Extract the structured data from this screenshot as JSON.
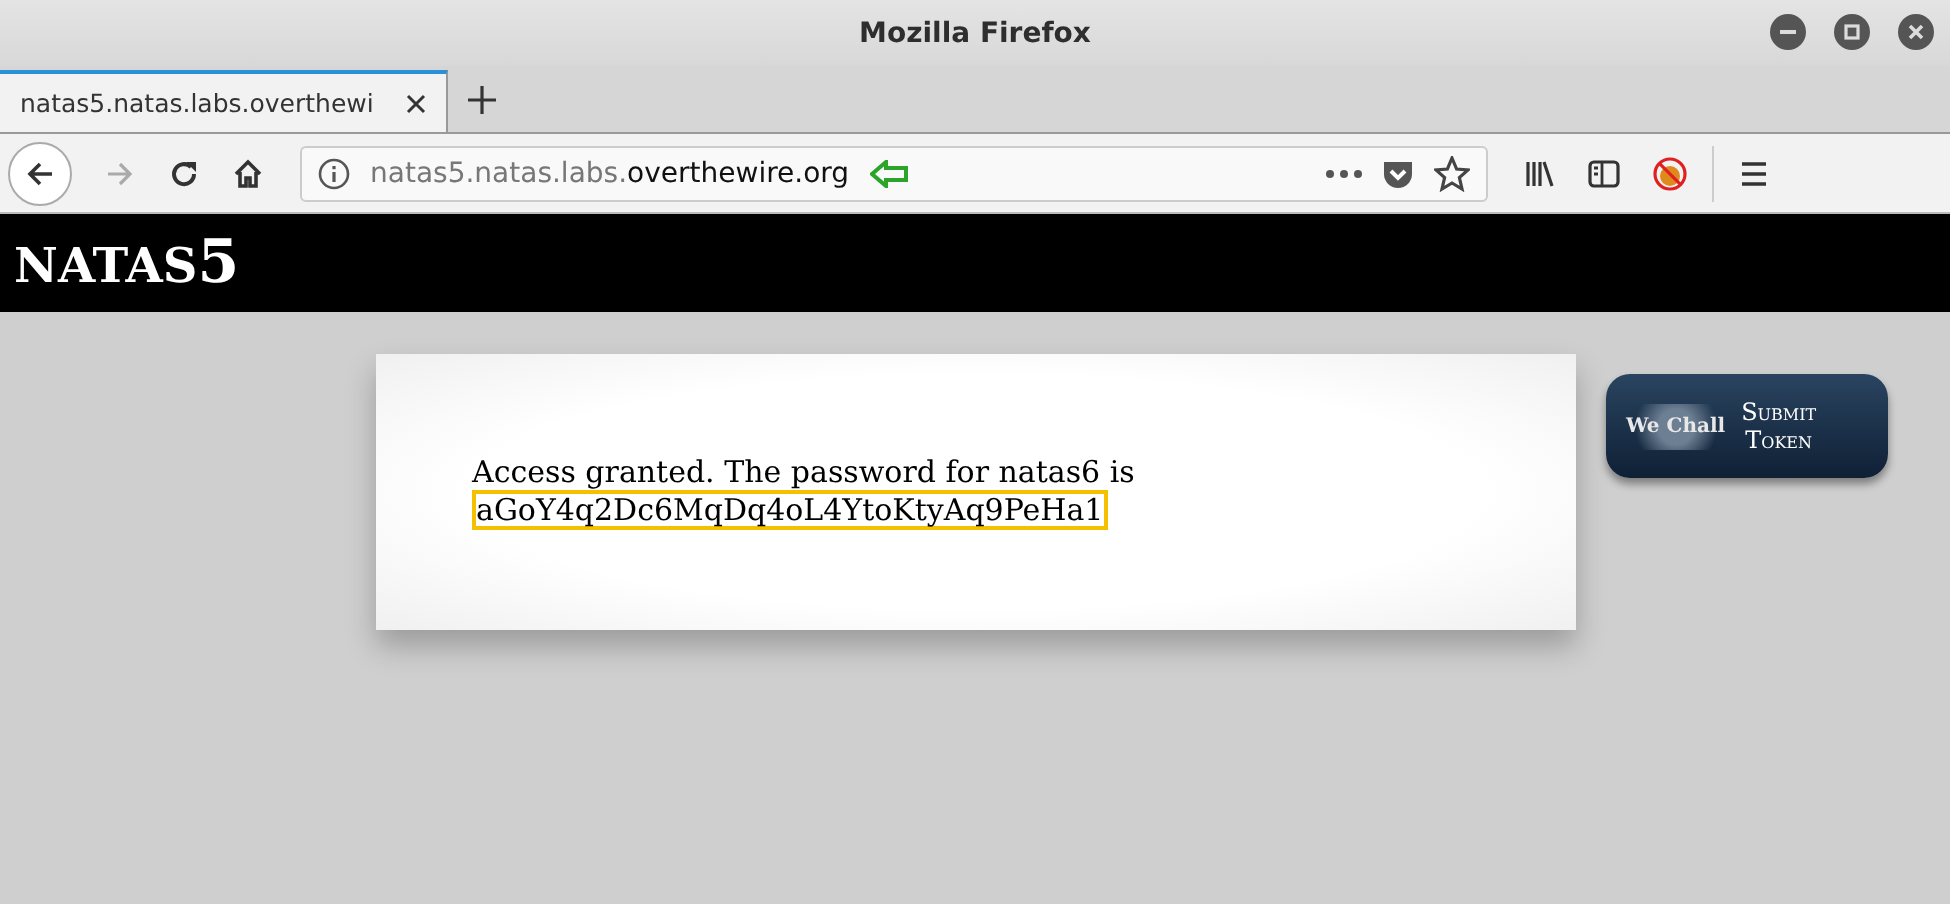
{
  "window": {
    "title": "Mozilla Firefox"
  },
  "tabs": [
    {
      "label": "natas5.natas.labs.overthewi",
      "selected": true
    }
  ],
  "address_bar": {
    "domain_prefix": "natas5.natas.labs.",
    "domain": "overthewire.org"
  },
  "page": {
    "heading": "NATAS",
    "heading_number": "5",
    "message": "Access granted. The password for natas6 is",
    "password": "aGoY4q2Dc6MqDq4oL4YtoKtyAq9PeHa1",
    "badge": {
      "logo": "We Chall",
      "line1": "Submit",
      "line2": "Token"
    }
  }
}
